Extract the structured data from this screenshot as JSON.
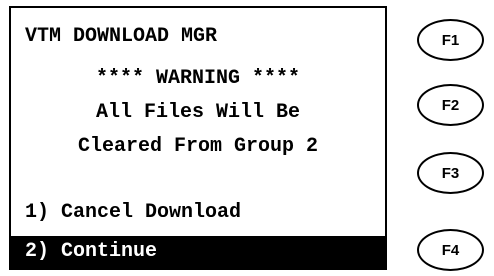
{
  "screen": {
    "title": "VTM DOWNLOAD MGR",
    "warning": "**** WARNING ****",
    "message_line1": "All Files Will Be",
    "message_line2": "Cleared From Group 2",
    "menu": [
      {
        "label": "1) Cancel Download",
        "selected": false
      },
      {
        "label": "2) Continue",
        "selected": true
      }
    ]
  },
  "function_keys": [
    {
      "label": "F1"
    },
    {
      "label": "F2"
    },
    {
      "label": "F3"
    },
    {
      "label": "F4"
    }
  ],
  "colors": {
    "background": "#ffffff",
    "text": "#000000",
    "selected_bg": "#000000",
    "selected_text": "#ffffff"
  }
}
